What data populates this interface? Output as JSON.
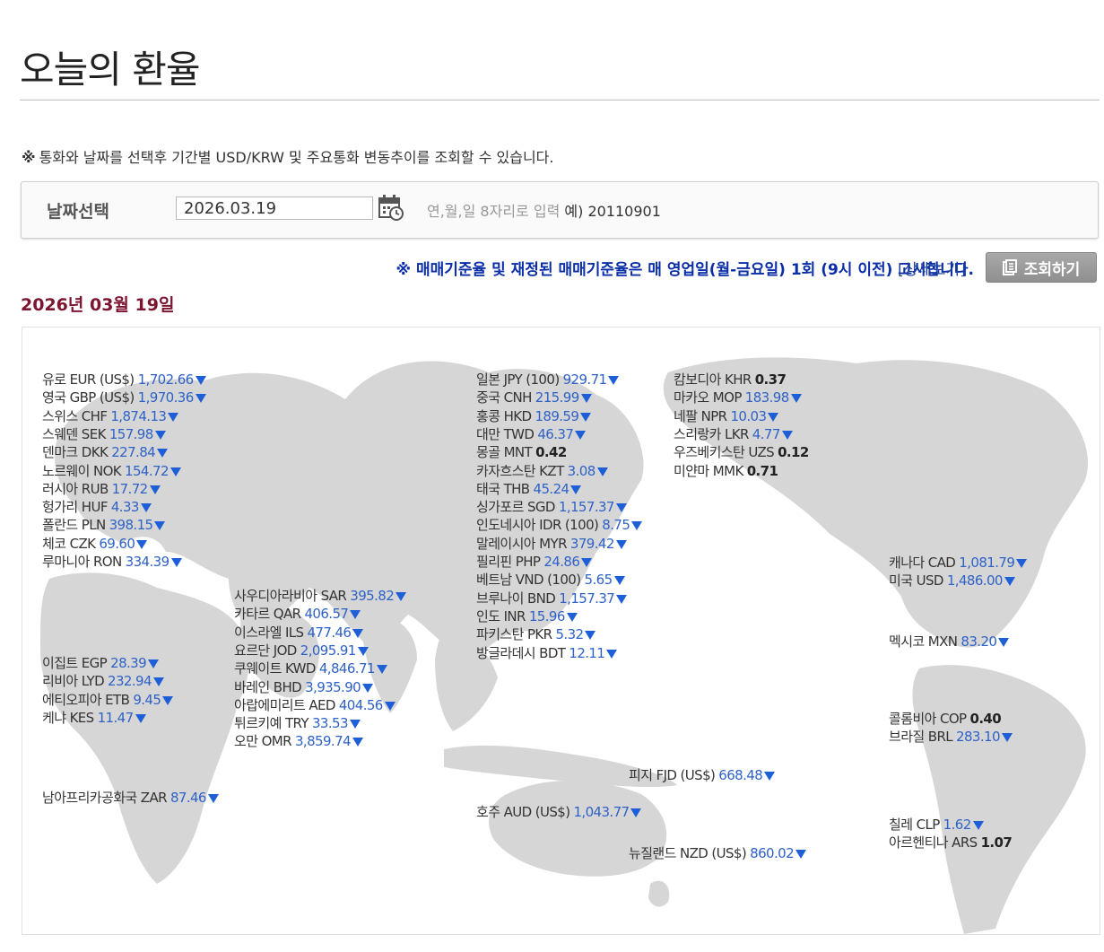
{
  "title": "오늘의 환율",
  "notice": {
    "mark": "※",
    "text": "통화와 날짜를 선택후 기간별 USD/KRW 및 주요통화 변동추이를 조회할 수 있습니다."
  },
  "date_select": {
    "label": "날짜선택",
    "value": "2026.03.19",
    "hint": "연,월,일 8자리로 입력",
    "example": "예) 20110901"
  },
  "gosi_notice": "※ 매매기준율 및 재정된 매매기준율은 매 영업일(월-금요일) 1회 (9시 이전) 고시합니다.",
  "detail_link": "[상세보기]",
  "search_button": "조회하기",
  "date_heading": "2026년 03월 19일",
  "colors": {
    "heading": "#7d1530",
    "value": "#2f62c7",
    "arrow_down": "#1e5fd8",
    "notice": "#0a2ea8"
  },
  "rates": [
    {
      "name": "유로 EUR (US$)",
      "value": "1,702.66",
      "trend": "down"
    },
    {
      "name": "영국 GBP (US$)",
      "value": "1,970.36",
      "trend": "down"
    },
    {
      "name": "스위스 CHF",
      "value": "1,874.13",
      "trend": "down"
    },
    {
      "name": "스웨덴 SEK",
      "value": "157.98",
      "trend": "down"
    },
    {
      "name": "덴마크 DKK",
      "value": "227.84",
      "trend": "down"
    },
    {
      "name": "노르웨이 NOK",
      "value": "154.72",
      "trend": "down"
    },
    {
      "name": "러시아 RUB",
      "value": "17.72",
      "trend": "down"
    },
    {
      "name": "헝가리 HUF",
      "value": "4.33",
      "trend": "down"
    },
    {
      "name": "폴란드 PLN",
      "value": "398.15",
      "trend": "down"
    },
    {
      "name": "체코 CZK",
      "value": "69.60",
      "trend": "down"
    },
    {
      "name": "루마니아 RON",
      "value": "334.39",
      "trend": "down"
    },
    {
      "name": "이집트 EGP",
      "value": "28.39",
      "trend": "down"
    },
    {
      "name": "리비아 LYD",
      "value": "232.94",
      "trend": "down"
    },
    {
      "name": "에티오피아 ETB",
      "value": "9.45",
      "trend": "down"
    },
    {
      "name": "케냐 KES",
      "value": "11.47",
      "trend": "down"
    },
    {
      "name": "남아프리카공화국 ZAR",
      "value": "87.46",
      "trend": "down"
    },
    {
      "name": "사우디아라비아 SAR",
      "value": "395.82",
      "trend": "down"
    },
    {
      "name": "카타르 QAR",
      "value": "406.57",
      "trend": "down"
    },
    {
      "name": "이스라엘 ILS",
      "value": "477.46",
      "trend": "down"
    },
    {
      "name": "요르단 JOD",
      "value": "2,095.91",
      "trend": "down"
    },
    {
      "name": "쿠웨이트 KWD",
      "value": "4,846.71",
      "trend": "down"
    },
    {
      "name": "바레인 BHD",
      "value": "3,935.90",
      "trend": "down"
    },
    {
      "name": "아랍에미리트 AED",
      "value": "404.56",
      "trend": "down"
    },
    {
      "name": "튀르키예 TRY",
      "value": "33.53",
      "trend": "down"
    },
    {
      "name": "오만 OMR",
      "value": "3,859.74",
      "trend": "down"
    },
    {
      "name": "일본 JPY (100)",
      "value": "929.71",
      "trend": "down"
    },
    {
      "name": "중국 CNH",
      "value": "215.99",
      "trend": "down"
    },
    {
      "name": "홍콩 HKD",
      "value": "189.59",
      "trend": "down"
    },
    {
      "name": "대만 TWD",
      "value": "46.37",
      "trend": "down"
    },
    {
      "name": "몽골 MNT",
      "value": "0.42",
      "trend": "none"
    },
    {
      "name": "카자흐스탄 KZT",
      "value": "3.08",
      "trend": "down"
    },
    {
      "name": "태국 THB",
      "value": "45.24",
      "trend": "down"
    },
    {
      "name": "싱가포르 SGD",
      "value": "1,157.37",
      "trend": "down"
    },
    {
      "name": "인도네시아 IDR (100)",
      "value": "8.75",
      "trend": "down"
    },
    {
      "name": "말레이시아 MYR",
      "value": "379.42",
      "trend": "down"
    },
    {
      "name": "필리핀 PHP",
      "value": "24.86",
      "trend": "down"
    },
    {
      "name": "베트남 VND (100)",
      "value": "5.65",
      "trend": "down"
    },
    {
      "name": "브루나이 BND",
      "value": "1,157.37",
      "trend": "down"
    },
    {
      "name": "인도 INR",
      "value": "15.96",
      "trend": "down"
    },
    {
      "name": "파키스탄 PKR",
      "value": "5.32",
      "trend": "down"
    },
    {
      "name": "방글라데시 BDT",
      "value": "12.11",
      "trend": "down"
    },
    {
      "name": "호주 AUD (US$)",
      "value": "1,043.77",
      "trend": "down"
    },
    {
      "name": "피지 FJD (US$)",
      "value": "668.48",
      "trend": "down"
    },
    {
      "name": "뉴질랜드 NZD (US$)",
      "value": "860.02",
      "trend": "down"
    },
    {
      "name": "캄보디아 KHR",
      "value": "0.37",
      "trend": "none"
    },
    {
      "name": "마카오 MOP",
      "value": "183.98",
      "trend": "down"
    },
    {
      "name": "네팔 NPR",
      "value": "10.03",
      "trend": "down"
    },
    {
      "name": "스리랑카 LKR",
      "value": "4.77",
      "trend": "down"
    },
    {
      "name": "우즈베키스탄 UZS",
      "value": "0.12",
      "trend": "none"
    },
    {
      "name": "미얀마 MMK",
      "value": "0.71",
      "trend": "none"
    },
    {
      "name": "캐나다 CAD",
      "value": "1,081.79",
      "trend": "down"
    },
    {
      "name": "미국 USD",
      "value": "1,486.00",
      "trend": "down"
    },
    {
      "name": "멕시코 MXN",
      "value": "83.20",
      "trend": "down"
    },
    {
      "name": "콜롬비아 COP",
      "value": "0.40",
      "trend": "none"
    },
    {
      "name": "브라질 BRL",
      "value": "283.10",
      "trend": "down"
    },
    {
      "name": "칠레 CLP",
      "value": "1.62",
      "trend": "down"
    },
    {
      "name": "아르헨티나 ARS",
      "value": "1.07",
      "trend": "none"
    }
  ]
}
